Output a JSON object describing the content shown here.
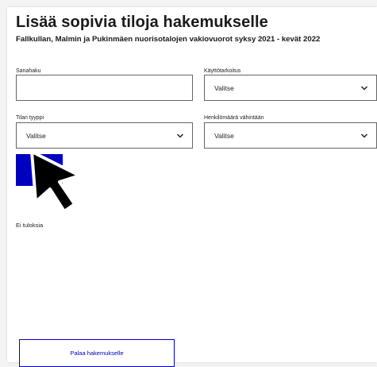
{
  "header": {
    "title": "Lisää sopivia tiloja hakemukselle",
    "subtitle": "Fallkullan, Malmin ja Pukinmäen nuorisotalojen vakiovuorot syksy 2021 - kevät 2022"
  },
  "filters": {
    "search": {
      "label": "Sanahaku",
      "value": ""
    },
    "purpose": {
      "label": "Käyttötarkoitus",
      "value": "Valitse"
    },
    "space_type": {
      "label": "Tilan tyyppi",
      "value": "Valitse"
    },
    "min_people": {
      "label": "Henkilömäärä vähintään",
      "value": "Valitse"
    }
  },
  "search_button": {
    "label": ""
  },
  "results": {
    "empty_text": "Ei tuloksia"
  },
  "back_button": {
    "label": "Palaa hakemukselle"
  },
  "colors": {
    "accent": "#0000bf",
    "border": "#666666",
    "background": "#f4f4f4"
  },
  "icons": {
    "dropdown": "chevron-down-icon",
    "cursor": "mouse-pointer-icon"
  }
}
